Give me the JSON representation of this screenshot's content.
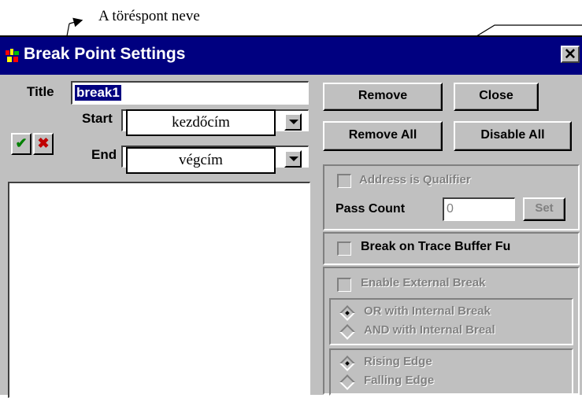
{
  "annotations": {
    "breakpoint_name": "A töréspont neve",
    "start_address": "kezdőcím",
    "end_address": "végcím"
  },
  "window": {
    "title": "Break Point Settings",
    "close_glyph": "✕"
  },
  "form": {
    "title_label": "Title",
    "title_value": "break1",
    "start_label": "Start",
    "end_label": "End",
    "ok_glyph": "✔",
    "cancel_glyph": "✖"
  },
  "buttons": {
    "remove": "Remove",
    "close": "Close",
    "remove_all": "Remove All",
    "disable_all": "Disable All",
    "set": "Set"
  },
  "options": {
    "address_is_qualifier": "Address is Qualifier",
    "pass_count_label": "Pass Count",
    "pass_count_value": "0",
    "break_on_trace": "Break on Trace Buffer Fu",
    "enable_external_break": "Enable External Break",
    "or_internal": "OR with Internal Break",
    "and_internal": "AND with Internal Breal",
    "rising_edge": "Rising Edge",
    "falling_edge": "Falling Edge"
  },
  "icons": {
    "app": "breakpoint-app-icon",
    "ok": "check-icon",
    "cancel": "cross-icon",
    "dropdown": "chevron-down-icon"
  },
  "colors": {
    "titlebar": "#000080",
    "face": "#c0c0c0",
    "selection": "#000080",
    "ok_green": "#008000",
    "cancel_red": "#c00000"
  }
}
